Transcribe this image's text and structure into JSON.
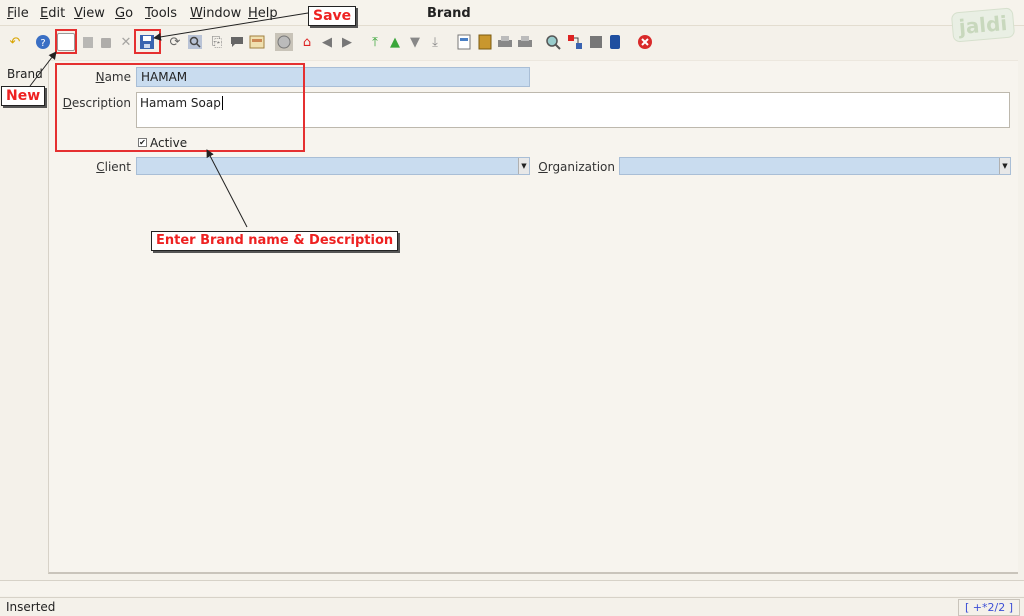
{
  "menu": [
    "File",
    "Edit",
    "View",
    "Go",
    "Tools",
    "Window",
    "Help"
  ],
  "window_title": "Brand",
  "logo_text": "jaldi",
  "toolbar": {
    "icons": [
      "undo-icon",
      "help-icon",
      "new-record-icon",
      "copy-record-icon",
      "delete-icon",
      "delete-selection-icon",
      "save-icon",
      "refresh-icon",
      "find-icon",
      "attachment-icon",
      "chat-icon",
      "multi-view-icon",
      "history-icon",
      "home-icon",
      "back-icon",
      "forward-icon",
      "first-record-icon",
      "previous-record-icon",
      "next-record-icon",
      "last-record-icon",
      "report-icon",
      "archive-icon",
      "print-preview-icon",
      "print-icon",
      "zoom-across-icon",
      "workflow-icon",
      "request-icon",
      "product-info-icon",
      "exit-icon"
    ]
  },
  "tree_label": "Brand",
  "form": {
    "name_label": "Name",
    "name_value": "HAMAM",
    "description_label": "Description",
    "description_value": "Hamam Soap",
    "active_label": "Active",
    "active_checked": true,
    "client_label": "Client",
    "organization_label": "Organization"
  },
  "annotations": {
    "new": "New",
    "save": "Save",
    "enter": "Enter Brand name & Description"
  },
  "status": {
    "message": "Inserted",
    "nav": "[ +*2/2 ]"
  }
}
